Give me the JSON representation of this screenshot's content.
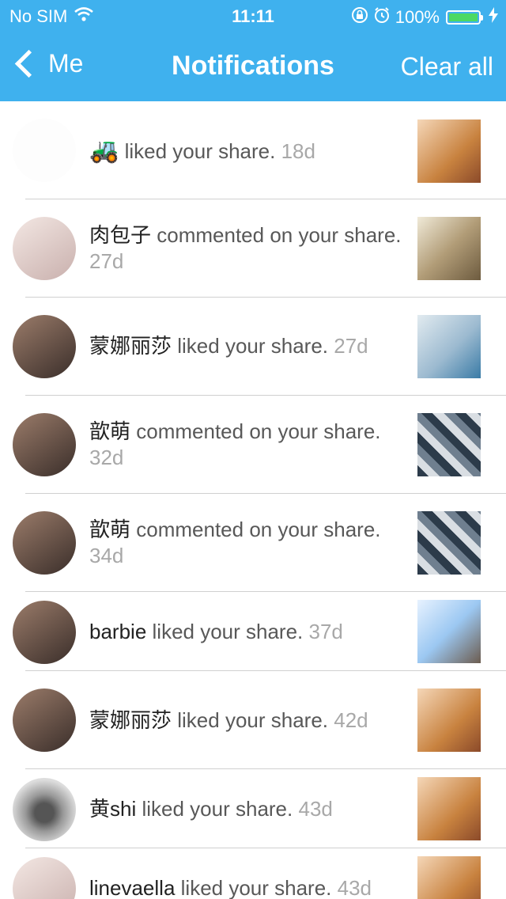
{
  "status_bar": {
    "carrier": "No SIM",
    "time": "11:11",
    "battery": "100%",
    "battery_level": 1.0
  },
  "nav": {
    "back_label": "Me",
    "title": "Notifications",
    "clear_label": "Clear all"
  },
  "colors": {
    "header": "#3fb1ee",
    "battery_fill": "#4cd964",
    "muted_text": "#a8a8a8",
    "body_text": "#585858"
  },
  "notifications": [
    {
      "user": "🚜",
      "action": "liked your share.",
      "age": "18d"
    },
    {
      "user": "肉包子",
      "action": "commented on your share.",
      "age": "27d"
    },
    {
      "user": "蒙娜丽莎",
      "action": "liked your share.",
      "age": "27d"
    },
    {
      "user": "歆萌",
      "action": "commented on your share.",
      "age": "32d"
    },
    {
      "user": "歆萌",
      "action": "commented on your share.",
      "age": "34d"
    },
    {
      "user": "barbie",
      "action": "liked your share.",
      "age": "37d"
    },
    {
      "user": "蒙娜丽莎",
      "action": "liked your share.",
      "age": "42d"
    },
    {
      "user": "黄shi",
      "action": "liked your share.",
      "age": "43d"
    },
    {
      "user": "linevaella",
      "action": "liked your share.",
      "age": "43d"
    }
  ]
}
